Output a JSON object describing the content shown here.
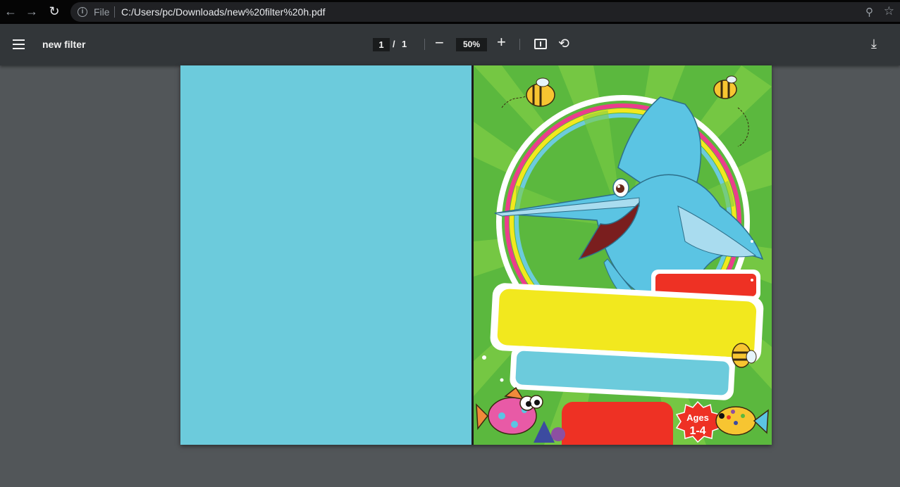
{
  "browser": {
    "back_icon": "arrow-left-icon",
    "forward_icon": "arrow-right-icon",
    "reload_icon": "reload-icon",
    "file_label": "File",
    "url": "C:/Users/pc/Downloads/new%20filter%20h.pdf"
  },
  "toolbar": {
    "title": "new filter",
    "current_page": "1",
    "separator": "/",
    "total_pages": "1",
    "zoom": "50%"
  },
  "cover": {
    "badge_line1": "Ages",
    "badge_line2": "1-4"
  },
  "colors": {
    "back_cover": "#6ccbdc",
    "front_green": "#5bb83e",
    "banner_yellow": "#f2e81e",
    "banner_red": "#ee3124",
    "banner_blue": "#6ccbdc"
  }
}
